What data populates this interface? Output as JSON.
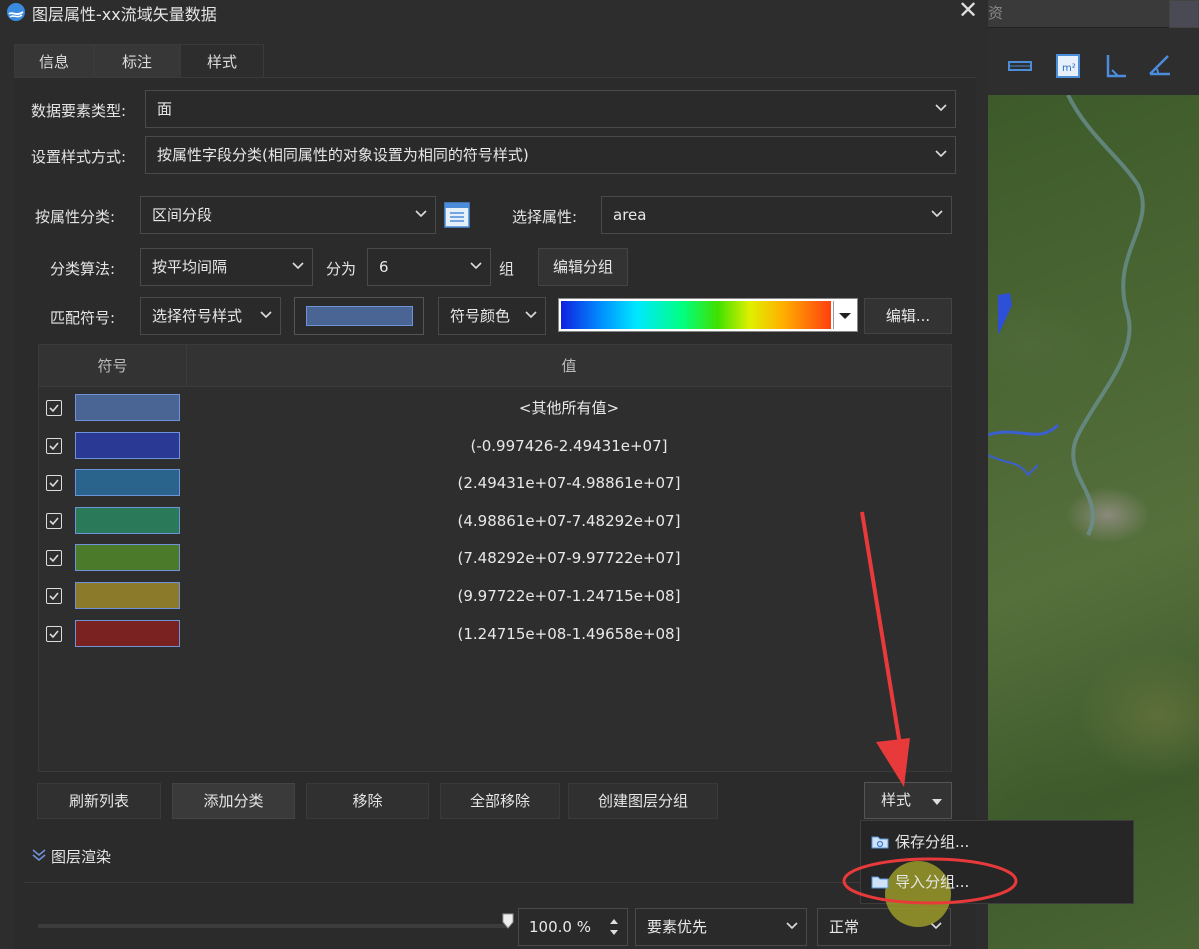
{
  "window": {
    "title": "图层属性-xx流域矢量数据",
    "close": "✕"
  },
  "background": {
    "top_label": "资"
  },
  "tabs": [
    {
      "label": "信息"
    },
    {
      "label": "标注"
    },
    {
      "label": "样式"
    }
  ],
  "form": {
    "feature_type_label": "数据要素类型:",
    "feature_type_value": "面",
    "style_mode_label": "设置样式方式:",
    "style_mode_value": "按属性字段分类(相同属性的对象设置为相同的符号样式)",
    "classify_by_label": "按属性分类:",
    "classify_by_value": "区间分段",
    "attr_label": "选择属性:",
    "attr_value": "area",
    "algo_label": "分类算法:",
    "algo_value": "按平均间隔",
    "divide_label": "分为",
    "divide_value": "6",
    "group_label": "组",
    "edit_groups": "编辑分组",
    "match_label": "匹配符号:",
    "symbol_style_value": "选择符号样式",
    "symbol_color_value": "符号颜色",
    "edit_btn": "编辑..."
  },
  "table": {
    "col_symbol": "符号",
    "col_value": "值",
    "rows": [
      {
        "value": "<其他所有值>",
        "color": "#4a6494"
      },
      {
        "value": "(-0.997426-2.49431e+07]",
        "color": "#2a3a94"
      },
      {
        "value": "(2.49431e+07-4.98861e+07]",
        "color": "#2a648c"
      },
      {
        "value": "(4.98861e+07-7.48292e+07]",
        "color": "#2a7a5a"
      },
      {
        "value": "(7.48292e+07-9.97722e+07]",
        "color": "#4a7a2a"
      },
      {
        "value": "(9.97722e+07-1.24715e+08]",
        "color": "#8a7a2a"
      },
      {
        "value": "(1.24715e+08-1.49658e+08]",
        "color": "#7a2222"
      }
    ]
  },
  "actions": {
    "refresh": "刷新列表",
    "add": "添加分类",
    "remove": "移除",
    "remove_all": "全部移除",
    "create_group": "创建图层分组",
    "style": "样式"
  },
  "menu": {
    "save": "保存分组...",
    "import": "导入分组..."
  },
  "render": {
    "section_label": "图层渲染",
    "opacity": "100.0 %",
    "priority": "要素优先",
    "blend": "正常"
  },
  "colors": {
    "accent_red": "#e8393b",
    "highlight": "#9a9a2a",
    "swatch_border": "#6f93d8"
  },
  "icons": {
    "list": "list-icon",
    "chevron": "chevron-down-icon",
    "checkbox": "checkbox-checked-icon",
    "folder": "folder-icon"
  }
}
